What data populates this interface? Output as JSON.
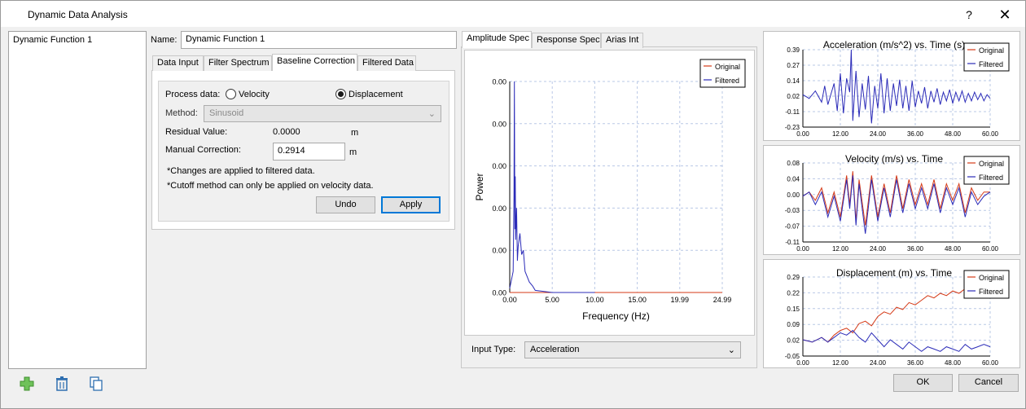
{
  "window": {
    "title": "Dynamic Data Analysis",
    "help": "?",
    "close": "✕"
  },
  "list": {
    "items": [
      "Dynamic Function 1"
    ]
  },
  "name_field": {
    "label": "Name:",
    "value": "Dynamic Function 1"
  },
  "left_tabs": [
    "Data Input",
    "Filter Spectrum",
    "Baseline Correction",
    "Filtered Data"
  ],
  "baseline": {
    "process_label": "Process data:",
    "velocity": "Velocity",
    "displacement": "Displacement",
    "selected": "displacement",
    "method_label": "Method:",
    "method_value": "Sinusoid",
    "residual_label": "Residual Value:",
    "residual_value": "0.0000",
    "residual_unit": "m",
    "manual_label": "Manual Correction:",
    "manual_value": "0.2914",
    "manual_unit": "m",
    "note1": "*Changes are applied to filtered data.",
    "note2": "*Cutoff method can only be applied on velocity data.",
    "undo": "Undo",
    "apply": "Apply"
  },
  "mid_tabs": [
    "Amplitude Spec",
    "Response Spec",
    "Arias Int"
  ],
  "input_type": {
    "label": "Input Type:",
    "value": "Acceleration"
  },
  "footer": {
    "ok": "OK",
    "cancel": "Cancel"
  },
  "colors": {
    "original": "#d53a17",
    "filtered": "#2b2bb8",
    "accent": "#0078d7",
    "grid": "#b9c8e6"
  },
  "icons": [
    "add-icon",
    "delete-icon",
    "copy-icon"
  ],
  "chart_data": [
    {
      "type": "line",
      "title": "",
      "xlabel": "Frequency (Hz)",
      "ylabel": "Power",
      "x_ticks": [
        "0.00",
        "5.00",
        "10.00",
        "15.00",
        "19.99",
        "24.99"
      ],
      "y_ticks": [
        "0.00",
        "0.00",
        "0.00",
        "0.00",
        "0.00",
        "0.00"
      ],
      "xlim": [
        0,
        24.99
      ],
      "ylim": [
        0,
        1
      ],
      "legend": [
        "Original",
        "Filtered"
      ],
      "legend_position": "top-right",
      "grid": true,
      "series": [
        {
          "name": "Original",
          "x": [
            0,
            24.99
          ],
          "y": [
            0,
            0
          ]
        },
        {
          "name": "Filtered",
          "x": [
            0.0,
            0.2,
            0.4,
            0.5,
            0.55,
            0.6,
            0.65,
            0.7,
            0.8,
            0.9,
            1.0,
            1.2,
            1.4,
            1.6,
            1.8,
            2.0,
            2.3,
            2.7,
            3.0,
            5.0,
            10.0
          ],
          "y": [
            0.02,
            0.06,
            0.1,
            0.45,
            1.0,
            0.3,
            0.55,
            0.25,
            0.4,
            0.15,
            0.22,
            0.28,
            0.18,
            0.2,
            0.1,
            0.08,
            0.05,
            0.03,
            0.01,
            0.0,
            0.0
          ]
        }
      ]
    },
    {
      "type": "line",
      "title": "Acceleration (m/s^2) vs. Time (s)",
      "x_ticks": [
        "0.00",
        "12.00",
        "24.00",
        "36.00",
        "48.00",
        "60.00"
      ],
      "y_ticks": [
        "0.39",
        "0.27",
        "0.14",
        "0.02",
        "-0.11",
        "-0.23"
      ],
      "xlim": [
        0,
        60
      ],
      "ylim": [
        -0.23,
        0.39
      ],
      "legend": [
        "Original",
        "Filtered"
      ],
      "legend_position": "top-right",
      "grid": true,
      "series": [
        {
          "name": "Filtered",
          "x": [
            0,
            2,
            4,
            6,
            7,
            8,
            10,
            11,
            12,
            13,
            14,
            15,
            15.5,
            16,
            17,
            18,
            19,
            20,
            21,
            22,
            23,
            24,
            25,
            26,
            27,
            28,
            29,
            30,
            31,
            32,
            33,
            34,
            35,
            36,
            37,
            38,
            39,
            40,
            41,
            42,
            43,
            44,
            45,
            46,
            47,
            48,
            49,
            50,
            51,
            52,
            53,
            54,
            55,
            56,
            57,
            58,
            59,
            60
          ],
          "y": [
            0.03,
            0.0,
            0.06,
            -0.03,
            0.1,
            -0.05,
            0.12,
            -0.1,
            0.2,
            -0.12,
            0.16,
            0.05,
            0.39,
            -0.18,
            0.22,
            -0.15,
            0.12,
            -0.09,
            0.18,
            -0.2,
            0.1,
            -0.08,
            0.2,
            -0.12,
            0.16,
            -0.1,
            0.12,
            -0.06,
            0.15,
            -0.08,
            0.1,
            -0.1,
            0.14,
            -0.07,
            0.06,
            -0.04,
            0.09,
            -0.08,
            0.06,
            -0.03,
            0.08,
            -0.05,
            0.05,
            -0.02,
            0.07,
            -0.04,
            0.05,
            -0.02,
            0.06,
            -0.03,
            0.04,
            -0.02,
            0.05,
            -0.01,
            0.04,
            -0.02,
            0.03,
            0.0
          ]
        }
      ]
    },
    {
      "type": "line",
      "title": "Velocity (m/s) vs. Time",
      "x_ticks": [
        "0.00",
        "12.00",
        "24.00",
        "36.00",
        "48.00",
        "60.00"
      ],
      "y_ticks": [
        "0.08",
        "0.04",
        "0.00",
        "-0.03",
        "-0.07",
        "-0.11"
      ],
      "xlim": [
        0,
        60
      ],
      "ylim": [
        -0.11,
        0.08
      ],
      "legend": [
        "Original",
        "Filtered"
      ],
      "legend_position": "top-right",
      "grid": true,
      "series": [
        {
          "name": "Original",
          "x": [
            0,
            2,
            4,
            6,
            8,
            10,
            12,
            14,
            15,
            16,
            17,
            18,
            20,
            22,
            24,
            26,
            28,
            30,
            32,
            34,
            36,
            38,
            40,
            42,
            44,
            46,
            48,
            50,
            52,
            54,
            56,
            58,
            60
          ],
          "y": [
            0.0,
            0.01,
            -0.01,
            0.02,
            -0.04,
            0.01,
            -0.05,
            0.05,
            -0.02,
            0.06,
            -0.06,
            0.04,
            -0.07,
            0.05,
            -0.05,
            0.03,
            -0.04,
            0.05,
            -0.03,
            0.04,
            -0.02,
            0.03,
            -0.02,
            0.04,
            -0.03,
            0.03,
            -0.01,
            0.03,
            -0.04,
            0.02,
            -0.01,
            0.01,
            0.01
          ]
        },
        {
          "name": "Filtered",
          "x": [
            0,
            2,
            4,
            6,
            8,
            10,
            12,
            14,
            15,
            16,
            17,
            18,
            20,
            22,
            24,
            26,
            28,
            30,
            32,
            34,
            36,
            38,
            40,
            42,
            44,
            46,
            48,
            50,
            52,
            54,
            56,
            58,
            60
          ],
          "y": [
            0.0,
            0.01,
            -0.02,
            0.01,
            -0.05,
            0.0,
            -0.06,
            0.04,
            -0.03,
            0.05,
            -0.07,
            0.03,
            -0.09,
            0.04,
            -0.06,
            0.02,
            -0.05,
            0.04,
            -0.04,
            0.03,
            -0.03,
            0.02,
            -0.03,
            0.03,
            -0.04,
            0.02,
            -0.02,
            0.02,
            -0.05,
            0.01,
            -0.02,
            0.0,
            0.01
          ]
        }
      ]
    },
    {
      "type": "line",
      "title": "Displacement (m) vs. Time",
      "x_ticks": [
        "0.00",
        "12.00",
        "24.00",
        "36.00",
        "48.00",
        "60.00"
      ],
      "y_ticks": [
        "0.29",
        "0.22",
        "0.15",
        "0.09",
        "0.02",
        "-0.05"
      ],
      "xlim": [
        0,
        60
      ],
      "ylim": [
        -0.05,
        0.29
      ],
      "legend": [
        "Original",
        "Filtered"
      ],
      "legend_position": "top-right",
      "grid": true,
      "series": [
        {
          "name": "Original",
          "x": [
            0,
            3,
            6,
            8,
            10,
            12,
            14,
            16,
            18,
            20,
            22,
            24,
            26,
            28,
            30,
            32,
            34,
            36,
            38,
            40,
            42,
            44,
            46,
            48,
            50,
            52,
            54,
            56
          ],
          "y": [
            0.02,
            0.01,
            0.03,
            0.01,
            0.04,
            0.06,
            0.07,
            0.05,
            0.09,
            0.1,
            0.08,
            0.12,
            0.14,
            0.13,
            0.16,
            0.15,
            0.18,
            0.17,
            0.19,
            0.21,
            0.2,
            0.22,
            0.21,
            0.23,
            0.22,
            0.24,
            0.23,
            0.28
          ]
        },
        {
          "name": "Filtered",
          "x": [
            0,
            3,
            6,
            8,
            10,
            12,
            14,
            16,
            18,
            20,
            22,
            24,
            26,
            28,
            30,
            32,
            34,
            36,
            38,
            40,
            42,
            44,
            46,
            48,
            50,
            52,
            54,
            56,
            58,
            60
          ],
          "y": [
            0.02,
            0.01,
            0.03,
            0.01,
            0.03,
            0.05,
            0.04,
            0.06,
            0.03,
            0.01,
            0.05,
            0.02,
            -0.01,
            0.02,
            0.0,
            -0.02,
            0.01,
            -0.01,
            -0.03,
            -0.01,
            -0.02,
            -0.03,
            -0.01,
            -0.02,
            -0.03,
            0.0,
            -0.02,
            -0.01,
            0.0,
            -0.01
          ]
        }
      ]
    }
  ]
}
